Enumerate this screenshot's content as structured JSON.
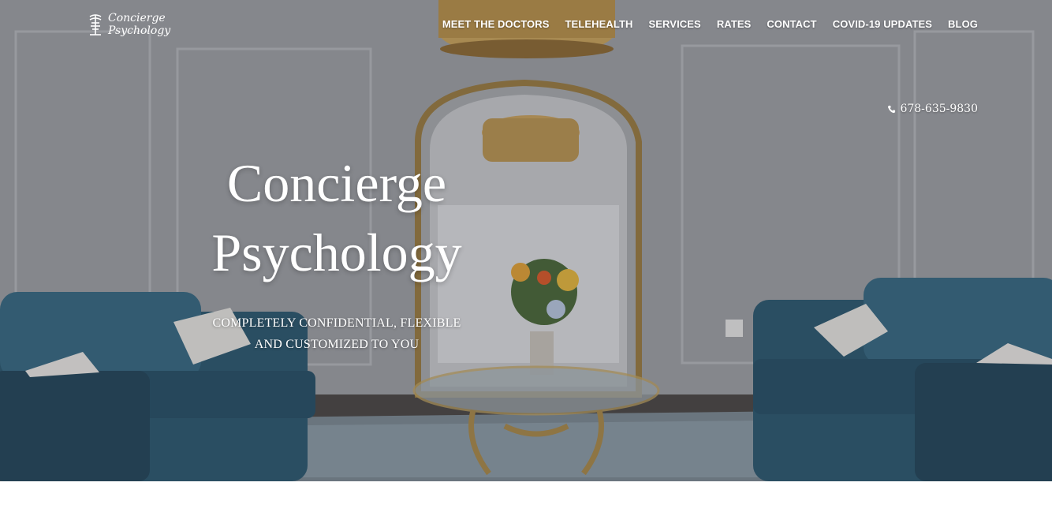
{
  "brand": {
    "line1": "Concierge",
    "line2": "Psychology"
  },
  "nav": {
    "items": [
      "MEET THE DOCTORS",
      "TELEHEALTH",
      "SERVICES",
      "RATES",
      "CONTACT",
      "COVID-19 UPDATES",
      "BLOG"
    ]
  },
  "contact": {
    "phone": "678-635-9830",
    "icon": "phone-icon"
  },
  "hero": {
    "title_line1": "Concierge",
    "title_line2": "Psychology",
    "tagline_line1": "COMPLETELY CONFIDENTIAL, FLEXIBLE",
    "tagline_line2": "AND CUSTOMIZED TO YOU"
  },
  "colors": {
    "text": "#ffffff",
    "sofa": "#2f5d73",
    "gold": "#b89a5a",
    "wall": "#9fa1a6"
  }
}
